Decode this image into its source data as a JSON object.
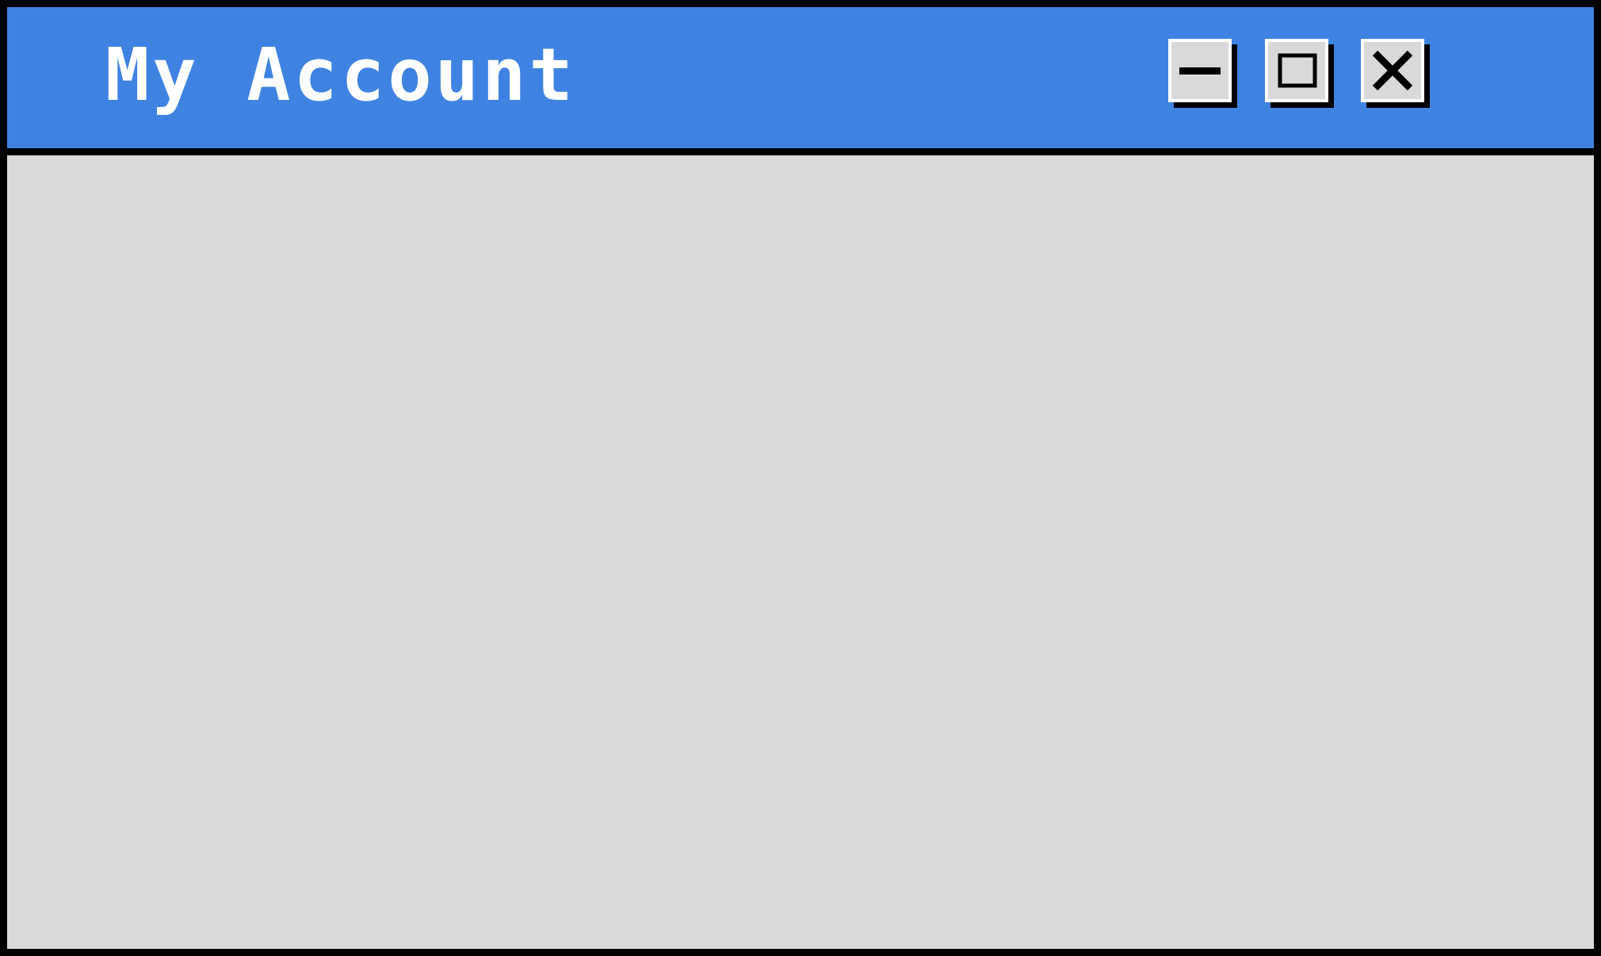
{
  "window": {
    "title": "My Account"
  },
  "titlebar_buttons": [
    {
      "name": "minimize",
      "icon": "minimize-icon"
    },
    {
      "name": "maximize",
      "icon": "maximize-icon"
    },
    {
      "name": "close",
      "icon": "close-icon"
    }
  ],
  "colors": {
    "titlebar": "#3f83e2",
    "body": "#d9d9d9",
    "frame": "#000000",
    "title_text": "#ffffff"
  }
}
